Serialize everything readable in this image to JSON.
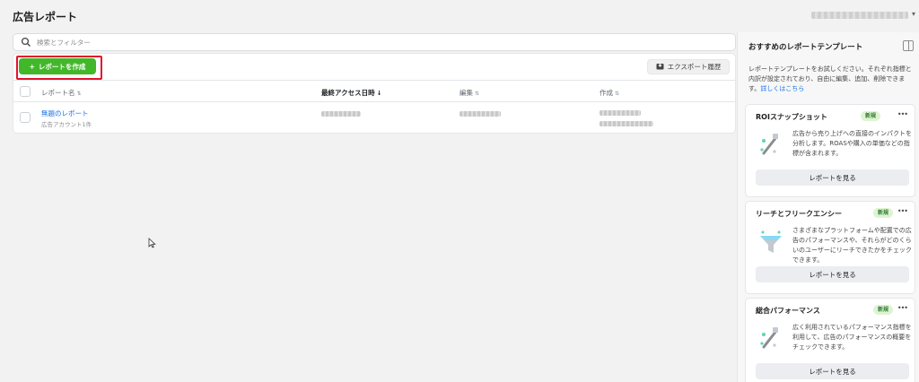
{
  "page": {
    "title": "広告レポート"
  },
  "search": {
    "placeholder": "検索とフィルター"
  },
  "toolbar": {
    "create_label": "レポートを作成",
    "create_plus": "+",
    "export_label": "エクスポート履歴"
  },
  "table": {
    "headers": {
      "name": "レポート名",
      "last_access": "最終アクセス日時",
      "edit": "編集",
      "created": "作成"
    },
    "rows": [
      {
        "name": "無題のレポート",
        "sub": "広告アカウント1件"
      }
    ]
  },
  "right_panel": {
    "title": "おすすめのレポートテンプレート",
    "desc": "レポートテンプレートをお試しください。それぞれ指標と内訳が設定されており、自由に編集、追加、削除できます。",
    "desc_link": "詳しくはこちら",
    "templates": [
      {
        "title": "ROIスナップショット",
        "badge": "新規",
        "text": "広告から売り上げへの直接のインパクトを分析します。ROASや購入の単価などの指標が含まれます。",
        "button": "レポートを見る"
      },
      {
        "title": "リーチとフリークエンシー",
        "badge": "新規",
        "text": "さまざまなプラットフォームや配置での広告のパフォーマンスや、それらがどのくらいのユーザーにリーチできたかをチェックできます。",
        "button": "レポートを見る"
      },
      {
        "title": "総合パフォーマンス",
        "badge": "新規",
        "text": "広く利用されているパフォーマンス指標を利用して、広告のパフォーマンスの概要をチェックできます。",
        "button": "レポートを見る"
      }
    ]
  },
  "icons": {
    "search": "search-icon",
    "export": "download-icon",
    "sort": "sort-icon",
    "more": "more-icon",
    "panel": "panel-toggle-icon",
    "cursor": "mouse-cursor-icon"
  },
  "colors": {
    "accent_green": "#42b72a",
    "highlight_red": "#e0142b",
    "link_blue": "#1a73e8",
    "badge_green": "#dff3d3"
  }
}
